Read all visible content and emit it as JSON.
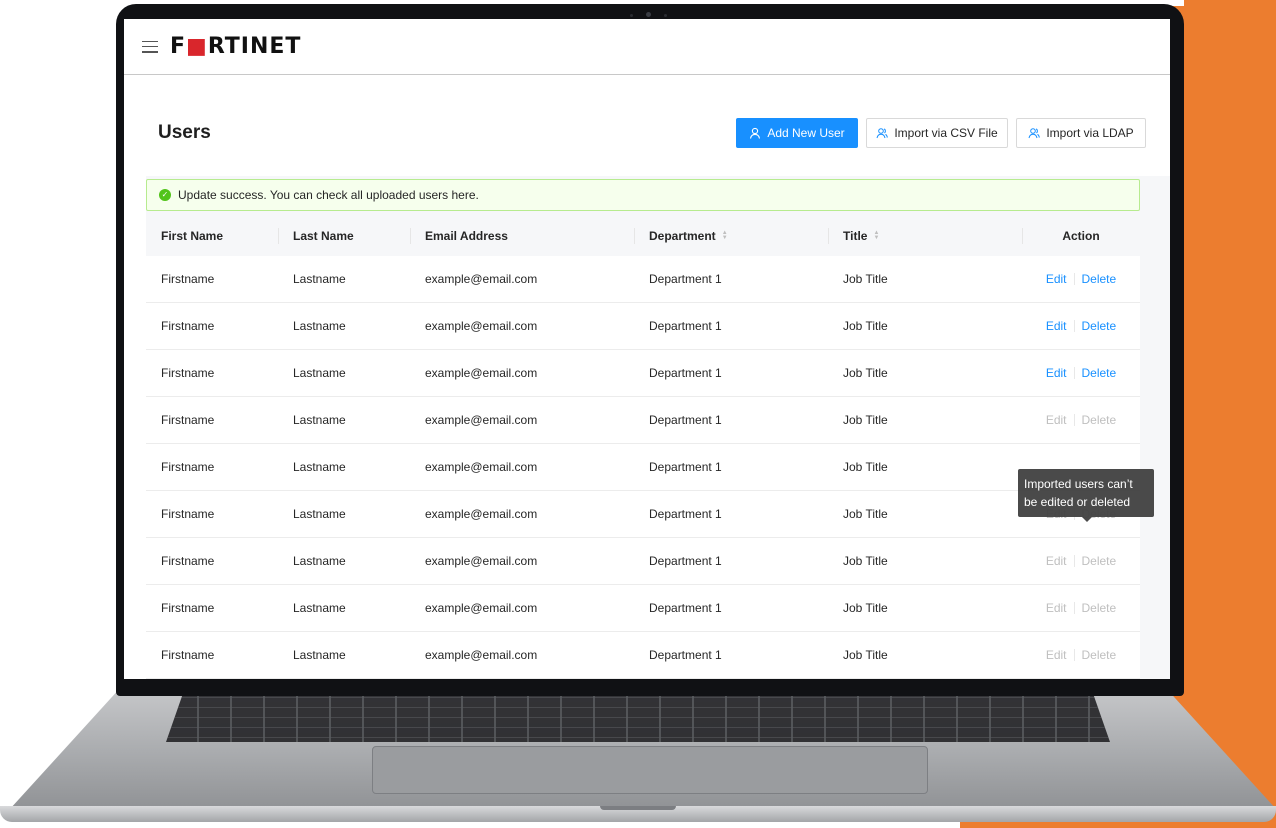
{
  "brand": {
    "logo_text_a": "F",
    "logo_mark": "■",
    "logo_text_b": "RTINET",
    "accent": "#ec7d2f",
    "primary": "#1890ff",
    "success": "#52c41a"
  },
  "header": {
    "menu_icon": "hamburger-icon"
  },
  "page": {
    "title": "Users",
    "buttons": {
      "add_new_user": "Add New User",
      "import_csv": "Import via CSV File",
      "import_ldap": "Import via LDAP"
    }
  },
  "alert": {
    "icon": "check-circle-icon",
    "text": "Update success. You can check all uploaded users here."
  },
  "table": {
    "columns": [
      "First Name",
      "Last Name",
      "Email Address",
      "Department",
      "Title",
      "Action"
    ],
    "sortable": [
      false,
      false,
      false,
      true,
      true,
      false
    ],
    "action_edit": "Edit",
    "action_delete": "Delete",
    "rows": [
      {
        "first": "Firstname",
        "last": "Lastname",
        "email": "example@email.com",
        "dept": "Department 1",
        "title": "Job Title",
        "editable": true
      },
      {
        "first": "Firstname",
        "last": "Lastname",
        "email": "example@email.com",
        "dept": "Department 1",
        "title": "Job Title",
        "editable": true
      },
      {
        "first": "Firstname",
        "last": "Lastname",
        "email": "example@email.com",
        "dept": "Department 1",
        "title": "Job Title",
        "editable": true
      },
      {
        "first": "Firstname",
        "last": "Lastname",
        "email": "example@email.com",
        "dept": "Department 1",
        "title": "Job Title",
        "editable": false
      },
      {
        "first": "Firstname",
        "last": "Lastname",
        "email": "example@email.com",
        "dept": "Department 1",
        "title": "Job Title",
        "editable": false,
        "hidden_action": true
      },
      {
        "first": "Firstname",
        "last": "Lastname",
        "email": "example@email.com",
        "dept": "Department 1",
        "title": "Job Title",
        "editable": false
      },
      {
        "first": "Firstname",
        "last": "Lastname",
        "email": "example@email.com",
        "dept": "Department 1",
        "title": "Job Title",
        "editable": false
      },
      {
        "first": "Firstname",
        "last": "Lastname",
        "email": "example@email.com",
        "dept": "Department 1",
        "title": "Job Title",
        "editable": false
      },
      {
        "first": "Firstname",
        "last": "Lastname",
        "email": "example@email.com",
        "dept": "Department 1",
        "title": "Job Title",
        "editable": false
      }
    ]
  },
  "tooltip": {
    "text": "Imported users can’t be edited or deleted"
  }
}
